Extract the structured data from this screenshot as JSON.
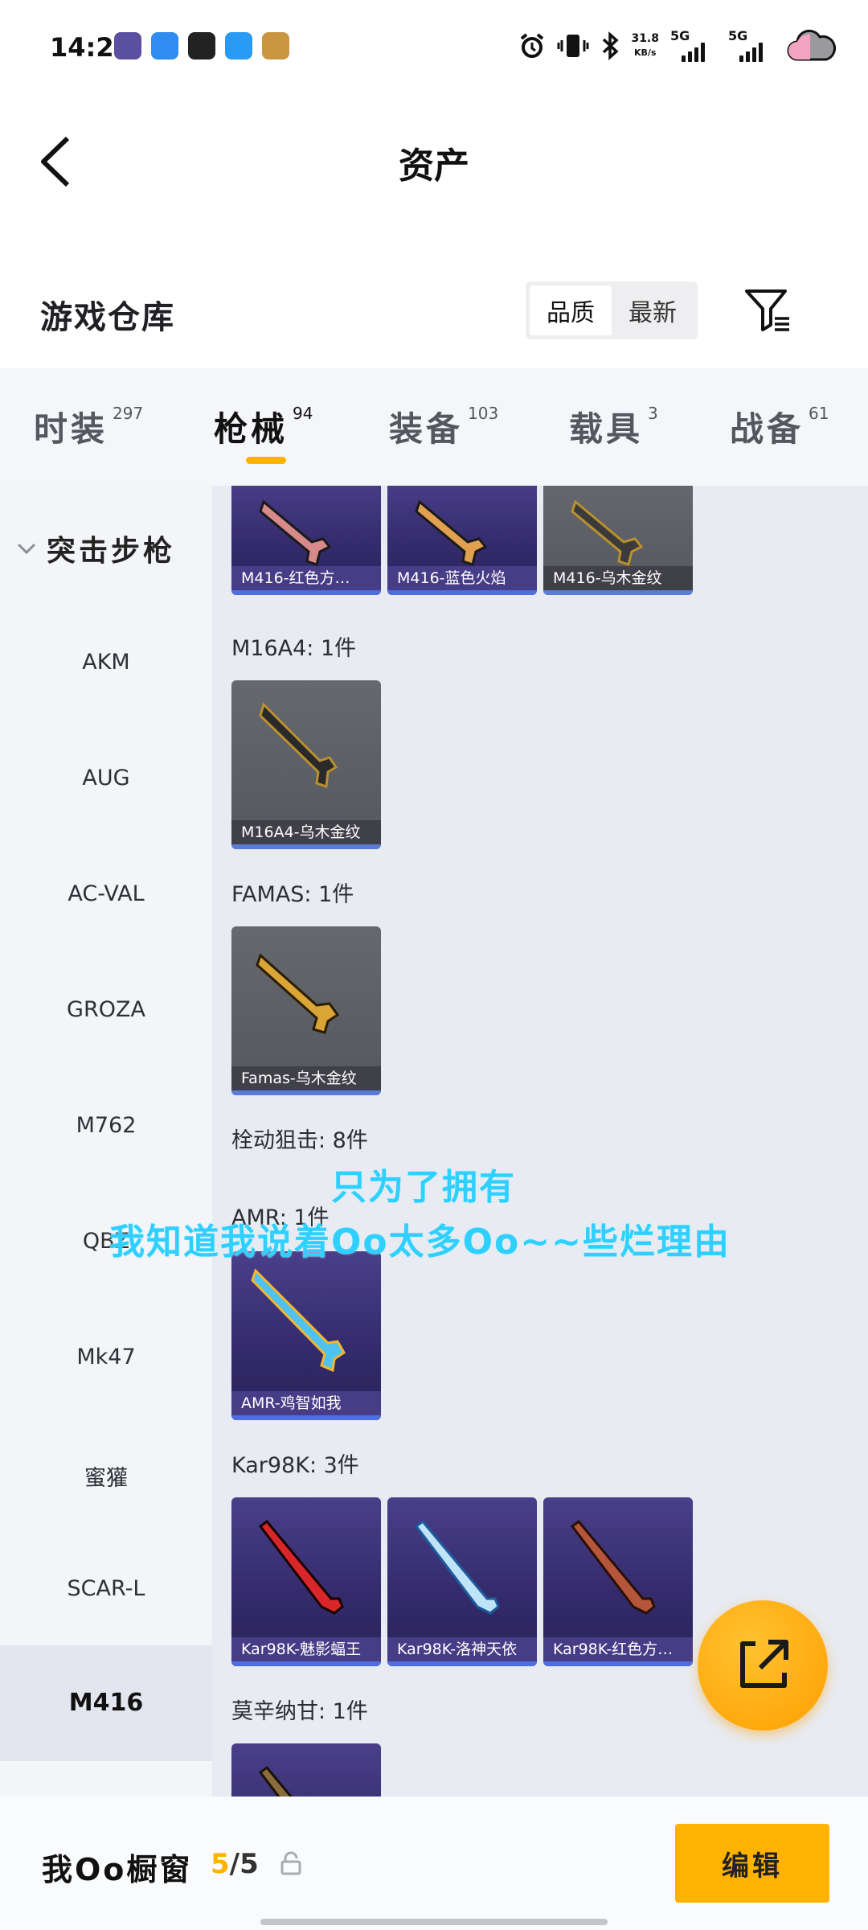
{
  "status_bar": {
    "time": "14:20",
    "net_speed_value": "31.8",
    "net_speed_unit": "KB/s",
    "sim1": "5G",
    "sim2": "5G"
  },
  "header": {
    "title": "资产"
  },
  "section": {
    "title": "游戏仓库",
    "sort_options": [
      "品质",
      "最新"
    ],
    "active_sort": "品质"
  },
  "tabs": [
    {
      "label": "时装",
      "count": "297"
    },
    {
      "label": "枪械",
      "count": "94"
    },
    {
      "label": "装备",
      "count": "103"
    },
    {
      "label": "载具",
      "count": "3"
    },
    {
      "label": "战备",
      "count": "61"
    }
  ],
  "active_tab": "枪械",
  "categories": {
    "group": "突击步枪",
    "items": [
      "AKM",
      "AUG",
      "AC-VAL",
      "GROZA",
      "M762",
      "QBZ",
      "Mk47",
      "蜜獾",
      "SCAR-L",
      "M416"
    ],
    "selected": "M416"
  },
  "content": {
    "top_row_cards": [
      "M416-红色方…",
      "M416-蓝色火焰",
      "M416-乌木金纹"
    ],
    "groups": [
      {
        "label": "M16A4: 1件",
        "cards": [
          "M16A4-乌木金纹"
        ]
      },
      {
        "label": "FAMAS: 1件",
        "cards": [
          "Famas-乌木金纹"
        ]
      },
      {
        "label": "栓动狙击: 8件"
      },
      {
        "label": "AMR: 1件",
        "cards": [
          "AMR-鸡智如我"
        ]
      },
      {
        "label": "Kar98K: 3件",
        "cards": [
          "Kar98K-魅影蝠王",
          "Kar98K-洛神天依",
          "Kar98K-红色方…"
        ]
      },
      {
        "label": "莫辛纳甘: 1件"
      }
    ]
  },
  "overlay_text": {
    "line1": "只为了拥有",
    "line2": "我知道我说着Oo太多Oo~~些烂理由"
  },
  "bottom_bar": {
    "showcase_label": "我Oo橱窗",
    "showcase_used": "5",
    "showcase_total": "/5",
    "edit_label": "编辑"
  },
  "colors": {
    "accent": "#ffb300",
    "rarity_blue": "#4e6ee0",
    "overlay_cyan": "#2fd0ff"
  }
}
